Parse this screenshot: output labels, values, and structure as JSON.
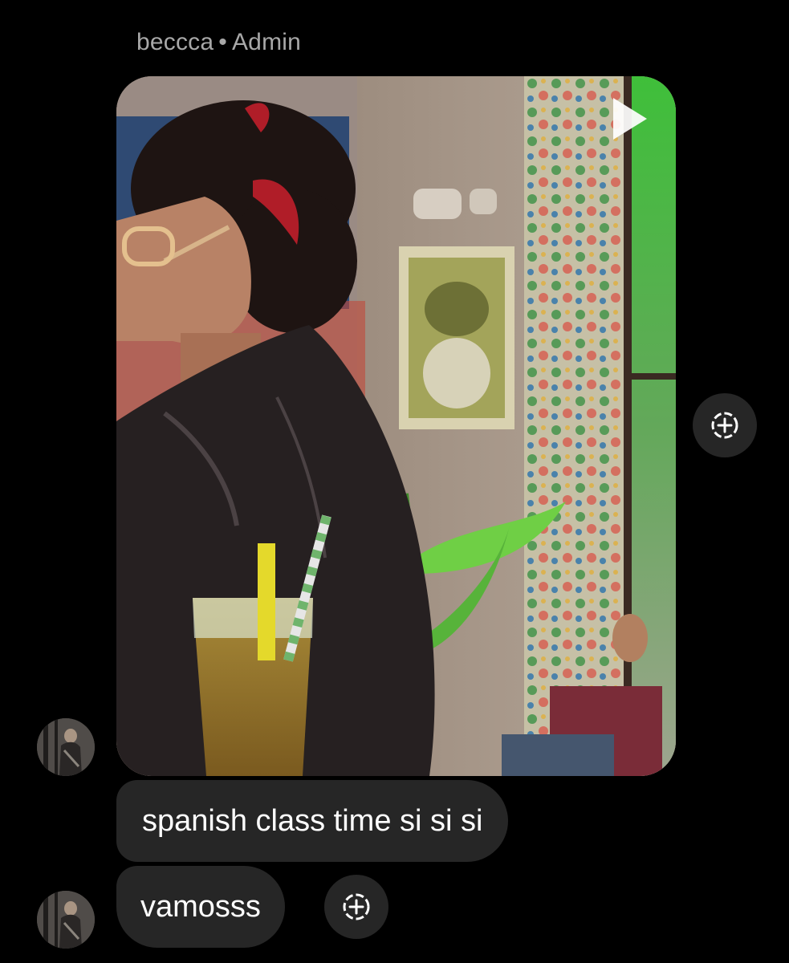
{
  "sender": {
    "name": "beccca",
    "separator": "•",
    "role": "Admin"
  },
  "media": {
    "kind": "video",
    "description_icon": "play-icon"
  },
  "messages": [
    {
      "text": "spanish class time si si si"
    },
    {
      "text": "vamosss"
    }
  ],
  "icons": {
    "share": "share-plus-icon",
    "avatar": "user-avatar"
  },
  "colors": {
    "background": "#000000",
    "bubble": "#262626",
    "sender_text": "#a8a8a8",
    "message_text": "#ffffff"
  }
}
